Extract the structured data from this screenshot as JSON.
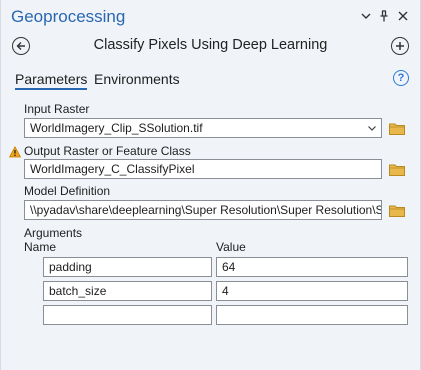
{
  "header": {
    "title": "Geoprocessing",
    "controls": [
      "chevron-down-icon",
      "pin-icon",
      "close-icon"
    ]
  },
  "nav": {
    "tool_title": "Classify Pixels Using Deep Learning",
    "back_icon": "back-arrow-icon",
    "add_icon": "add-icon"
  },
  "tabs": [
    {
      "label": "Parameters",
      "active": true
    },
    {
      "label": "Environments",
      "active": false
    }
  ],
  "help_icon": "help-icon",
  "colors": {
    "accent": "#2a67b1",
    "pane_bg": "#f0f4f9",
    "folder": "#e8b84a",
    "warning": "#f0a31a"
  },
  "params": {
    "input_raster": {
      "label": "Input Raster",
      "value": "WorldImagery_Clip_SSolution.tif"
    },
    "output_raster": {
      "label": "Output Raster or Feature Class",
      "value": "WorldImagery_C_ClassifyPixel",
      "warning": true
    },
    "model_definition": {
      "label": "Model Definition",
      "value": "\\\\pyadav\\share\\deeplearning\\Super Resolution\\Super Resolution\\Super Resolution.emd"
    },
    "arguments": {
      "label": "Arguments",
      "columns": [
        "Name",
        "Value"
      ],
      "rows": [
        {
          "name": "padding",
          "value": "64"
        },
        {
          "name": "batch_size",
          "value": "4"
        },
        {
          "name": "",
          "value": ""
        }
      ]
    }
  }
}
